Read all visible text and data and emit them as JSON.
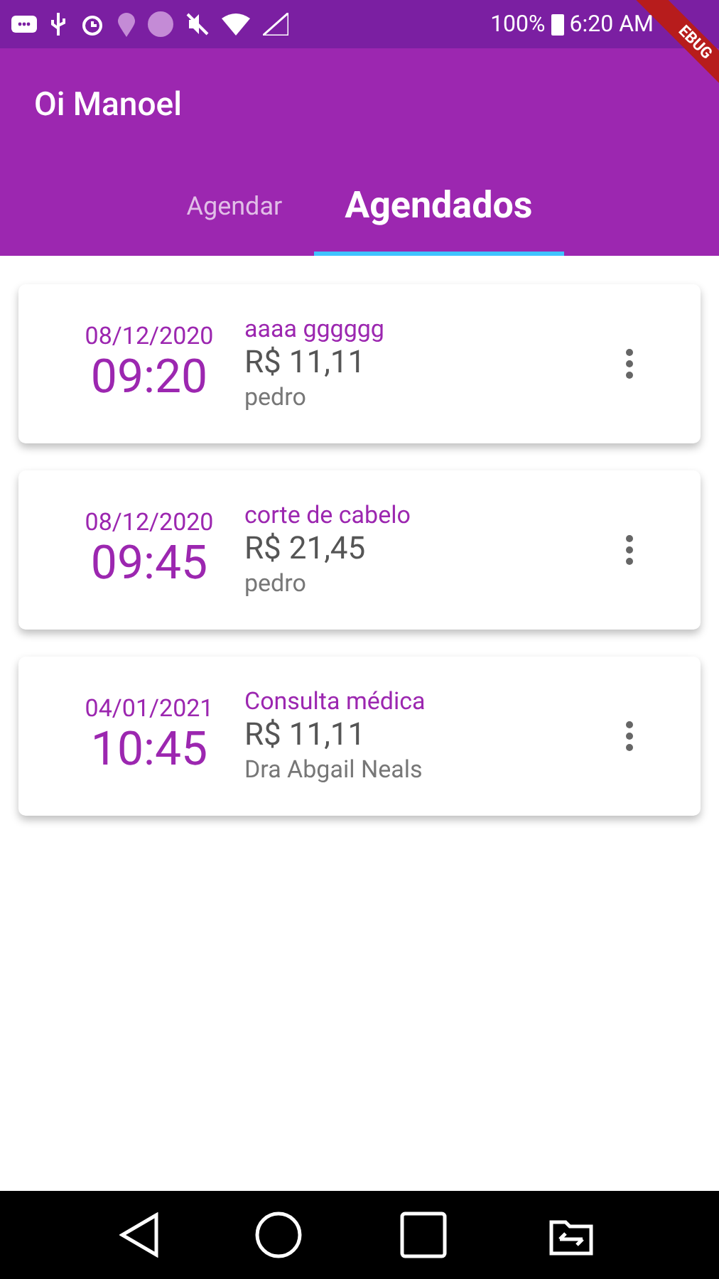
{
  "status_bar": {
    "battery": "100%",
    "time": "6:20 AM"
  },
  "debug_banner": "EBUG",
  "app_bar": {
    "title": "Oi Manoel"
  },
  "tabs": [
    {
      "label": "Agendar",
      "selected": false
    },
    {
      "label": "Agendados",
      "selected": true
    }
  ],
  "appointments": [
    {
      "date": "08/12/2020",
      "time": "09:20",
      "service": "aaaa gggggg",
      "price": "R$ 11,11",
      "professional": "pedro"
    },
    {
      "date": "08/12/2020",
      "time": "09:45",
      "service": "corte de cabelo",
      "price": "R$ 21,45",
      "professional": "pedro"
    },
    {
      "date": "04/01/2021",
      "time": "10:45",
      "service": "Consulta médica",
      "price": "R$ 11,11",
      "professional": "Dra Abgail Neals"
    }
  ]
}
